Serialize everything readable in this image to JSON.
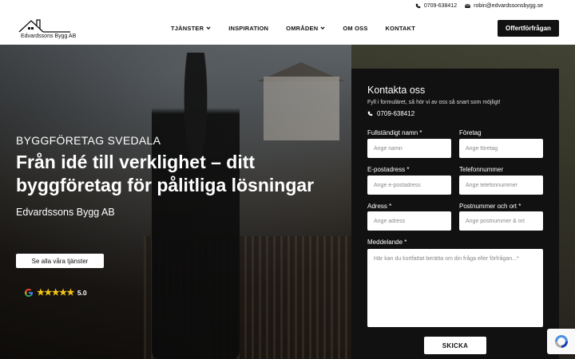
{
  "topbar": {
    "phone": "0709-638412",
    "email": "robin@edvardssonsbygg.se"
  },
  "header": {
    "logo_text": "Edvardssons Bygg AB",
    "nav": [
      {
        "label": "TJÄNSTER",
        "dropdown": true
      },
      {
        "label": "INSPIRATION",
        "dropdown": false
      },
      {
        "label": "OMRÅDEN",
        "dropdown": true
      },
      {
        "label": "OM OSS",
        "dropdown": false
      },
      {
        "label": "KONTAKT",
        "dropdown": false
      }
    ],
    "cta_label": "Offertförfrågan"
  },
  "hero": {
    "eyebrow": "BYGGFÖRETAG SVEDALA",
    "headline": "Från idé till verklighet – ditt byggföretag för pålitliga lösningar",
    "company": "Edvardssons Bygg AB",
    "services_button": "Se alla våra tjänster",
    "rating": "5.0",
    "rating_stars": 5
  },
  "form": {
    "title": "Kontakta oss",
    "subtitle": "Fyll i formuläret, så hör vi av oss så snart som möjligt!",
    "phone": "0709-638412",
    "fields": {
      "name": {
        "label": "Fullständigt namn *",
        "placeholder": "Ange namn"
      },
      "company": {
        "label": "Företag",
        "placeholder": "Ange företag"
      },
      "email": {
        "label": "E-postadress *",
        "placeholder": "Ange e-postadress"
      },
      "phone": {
        "label": "Telefonnummer",
        "placeholder": "Ange telefonnummer"
      },
      "address": {
        "label": "Adress *",
        "placeholder": "Ange adress"
      },
      "postal": {
        "label": "Postnummer och ort *",
        "placeholder": "Ange postnummer & ort"
      },
      "message": {
        "label": "Meddelande *",
        "placeholder": "Här kan du kortfattat berätta om din fråga eller förfrågan...*"
      }
    },
    "submit_label": "SKICKA"
  },
  "colors": {
    "dark": "#111111",
    "star": "#f5c518",
    "white": "#ffffff"
  }
}
